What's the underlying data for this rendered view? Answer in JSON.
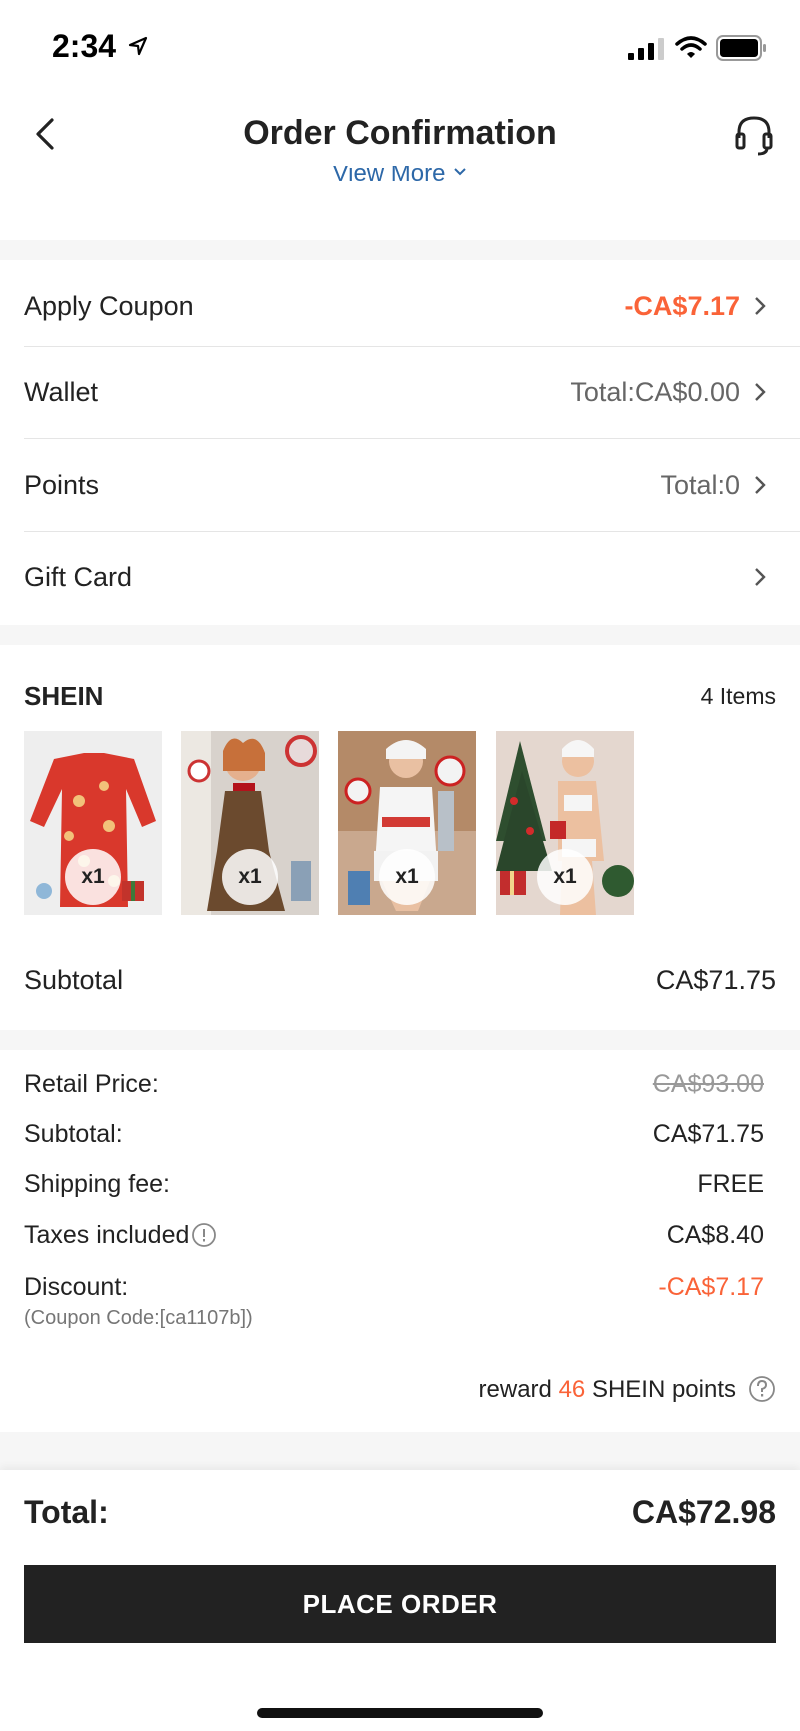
{
  "status_bar": {
    "time": "2:34",
    "icons": [
      "location-arrow-icon",
      "cellular-signal-icon",
      "wifi-icon",
      "battery-icon"
    ]
  },
  "nav": {
    "title": "Order Confirmation",
    "view_more": "View More",
    "icons": [
      "back-arrow-icon",
      "customer-support-icon"
    ]
  },
  "payment_options": [
    {
      "label": "Apply Coupon",
      "value": "-CA$7.17"
    },
    {
      "label": "Wallet",
      "value": "Total:CA$0.00"
    },
    {
      "label": "Points",
      "value": "Total:0"
    },
    {
      "label": "Gift Card",
      "value": ""
    }
  ],
  "store": {
    "name": "SHEIN",
    "items_count": "4 Items",
    "items": [
      {
        "qty": "x1"
      },
      {
        "qty": "x1"
      },
      {
        "qty": "x1"
      },
      {
        "qty": "x1"
      }
    ],
    "subtotal_label": "Subtotal",
    "subtotal_value": "CA$71.75"
  },
  "summary": {
    "retail_label": "Retail Price:",
    "retail_value": "CA$93.00",
    "subtotal_label": "Subtotal:",
    "subtotal_value": "CA$71.75",
    "shipping_label": "Shipping fee:",
    "shipping_value": "FREE",
    "taxes_label": "Taxes included",
    "taxes_value": "CA$8.40",
    "discount_label": "Discount:",
    "discount_value": "-CA$7.17",
    "coupon_code": "(Coupon Code:[ca1107b])",
    "reward_prefix": "reward",
    "reward_points": "46",
    "reward_suffix": "SHEIN points"
  },
  "footer": {
    "total_label": "Total:",
    "total_value": "CA$72.98",
    "button_label": "PLACE ORDER"
  },
  "colors": {
    "accent": "#fa6338",
    "link": "#2d68a8",
    "button": "#222222"
  }
}
